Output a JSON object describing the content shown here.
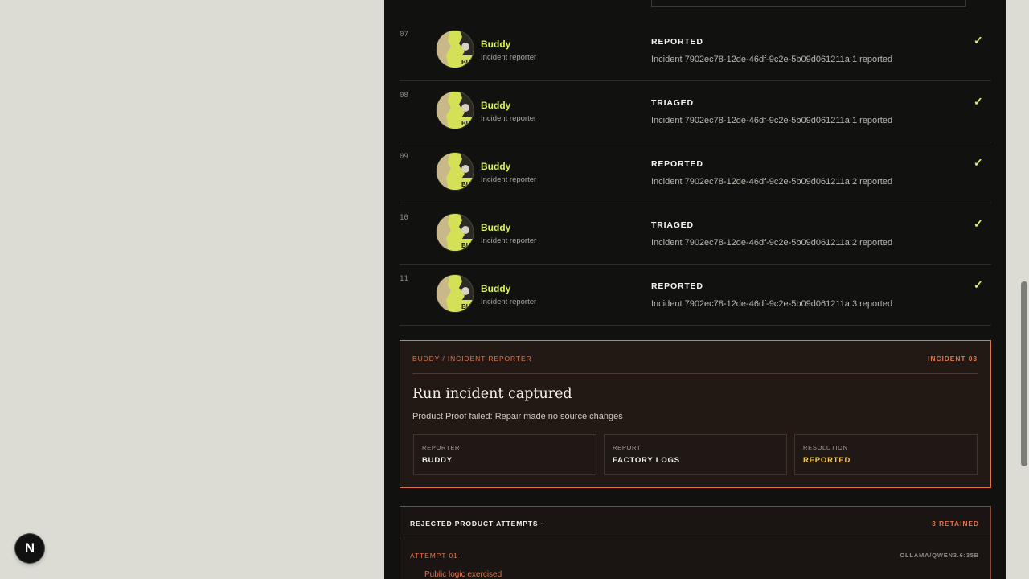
{
  "timeline": {
    "rows": [
      {
        "num": "07",
        "agent": "Buddy",
        "role": "Incident reporter",
        "status": "REPORTED",
        "detail": "Incident 7902ec78-12de-46df-9c2e-5b09d061211a:1 reported",
        "check": "✓"
      },
      {
        "num": "08",
        "agent": "Buddy",
        "role": "Incident reporter",
        "status": "TRIAGED",
        "detail": "Incident 7902ec78-12de-46df-9c2e-5b09d061211a:1 reported",
        "check": "✓"
      },
      {
        "num": "09",
        "agent": "Buddy",
        "role": "Incident reporter",
        "status": "REPORTED",
        "detail": "Incident 7902ec78-12de-46df-9c2e-5b09d061211a:2 reported",
        "check": "✓"
      },
      {
        "num": "10",
        "agent": "Buddy",
        "role": "Incident reporter",
        "status": "TRIAGED",
        "detail": "Incident 7902ec78-12de-46df-9c2e-5b09d061211a:2 reported",
        "check": "✓"
      },
      {
        "num": "11",
        "agent": "Buddy",
        "role": "Incident reporter",
        "status": "REPORTED",
        "detail": "Incident 7902ec78-12de-46df-9c2e-5b09d061211a:3 reported",
        "check": "✓"
      }
    ]
  },
  "incident": {
    "eyebrow": "BUDDY / INCIDENT REPORTER",
    "tag": "INCIDENT 03",
    "title": "Run incident captured",
    "description": "Product Proof failed: Repair made no source changes",
    "stats": [
      {
        "label": "REPORTER",
        "value": "BUDDY"
      },
      {
        "label": "REPORT",
        "value": "FACTORY LOGS"
      },
      {
        "label": "RESOLUTION",
        "value": "REPORTED"
      }
    ]
  },
  "rejected": {
    "title": "REJECTED PRODUCT ATTEMPTS ·",
    "count": "3 RETAINED",
    "attempt_label": "ATTEMPT 01 ·",
    "attempt_model": "OLLAMA/QWEN3.6:35B",
    "attempt_item": "Public logic exercised"
  },
  "dev_badge": "N",
  "colors": {
    "accent_lime": "#d6f25c",
    "accent_orange": "#e0744d",
    "resolution_yellow": "#f2c84b",
    "panel_bg": "#111110",
    "page_bg": "#dcdcd5"
  },
  "icons": {
    "avatar": "buddy-avatar-icon",
    "check": "check-icon",
    "dev_badge": "nextjs-logo-icon"
  }
}
